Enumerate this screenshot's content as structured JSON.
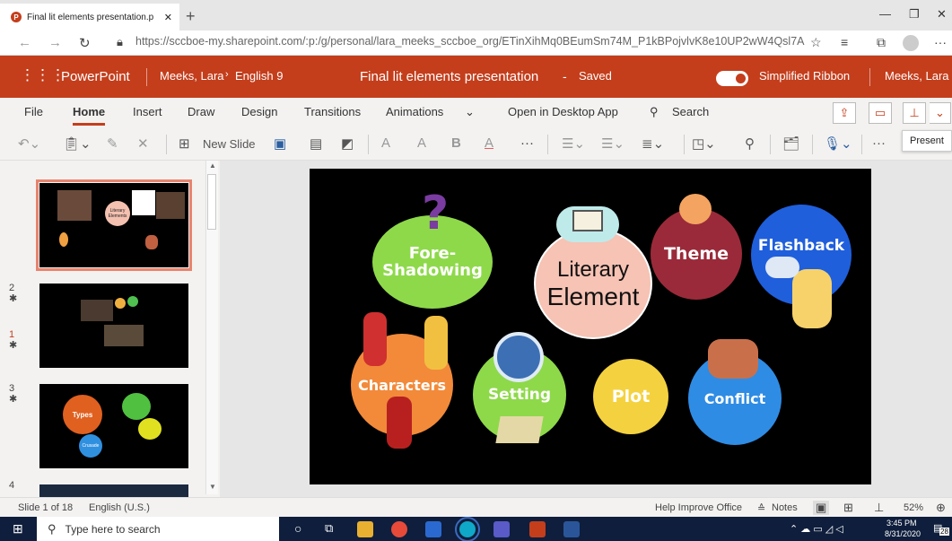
{
  "browser": {
    "tab_title": "Final lit elements presentation.p",
    "tab_icon": "P",
    "url": "https://sccboe-my.sharepoint.com/:p:/g/personal/lara_meeks_sccboe_org/ETinXihMq0BEumSm74M_P1kBPojvlvK8e10UP2wW4Qsl7A",
    "url_host_part": "sccboe-my.sharepoint.com"
  },
  "header": {
    "app": "PowerPoint",
    "breadcrumb_user": "Meeks, Lara",
    "breadcrumb_folder": "English 9",
    "doc_title": "Final lit elements presentation",
    "doc_status": "Saved",
    "toggle_label": "Simplified Ribbon",
    "account": "Meeks, Lara"
  },
  "ribbon_tabs": [
    "File",
    "Home",
    "Insert",
    "Draw",
    "Design",
    "Transitions",
    "Animations"
  ],
  "ribbon_extra": {
    "open_desktop": "Open in Desktop App",
    "search": "Search"
  },
  "toolbar": {
    "new_slide": "New Slide",
    "font_a": "A",
    "font_b": "B",
    "more": "···"
  },
  "tooltip": "Present",
  "thumbnails": [
    {
      "num": "1",
      "star": "✱"
    },
    {
      "num": "2",
      "star": "✱"
    },
    {
      "num": "3",
      "star": "✱"
    },
    {
      "num": "4",
      "star": ""
    }
  ],
  "thumb1_label": "Literary Elements",
  "thumb3_labels": [
    "Types",
    "Crusade"
  ],
  "slide": {
    "center": [
      "Literary",
      "Element"
    ],
    "items": [
      "Fore-",
      "Shadowing",
      "Theme",
      "Flashback",
      "Characters",
      "Setting",
      "Plot",
      "Conflict"
    ],
    "question_mark": "?"
  },
  "status": {
    "slide_of": "Slide 1 of 18",
    "language": "English (U.S.)",
    "help": "Help Improve Office",
    "notes": "Notes",
    "zoom": "52%"
  },
  "taskbar": {
    "search": "Type here to search",
    "time": "3:45 PM",
    "date": "8/31/2020",
    "notif_count": "28"
  },
  "colors": {
    "brand": "#c43e1c",
    "taskbar": "#0f1e3c"
  }
}
